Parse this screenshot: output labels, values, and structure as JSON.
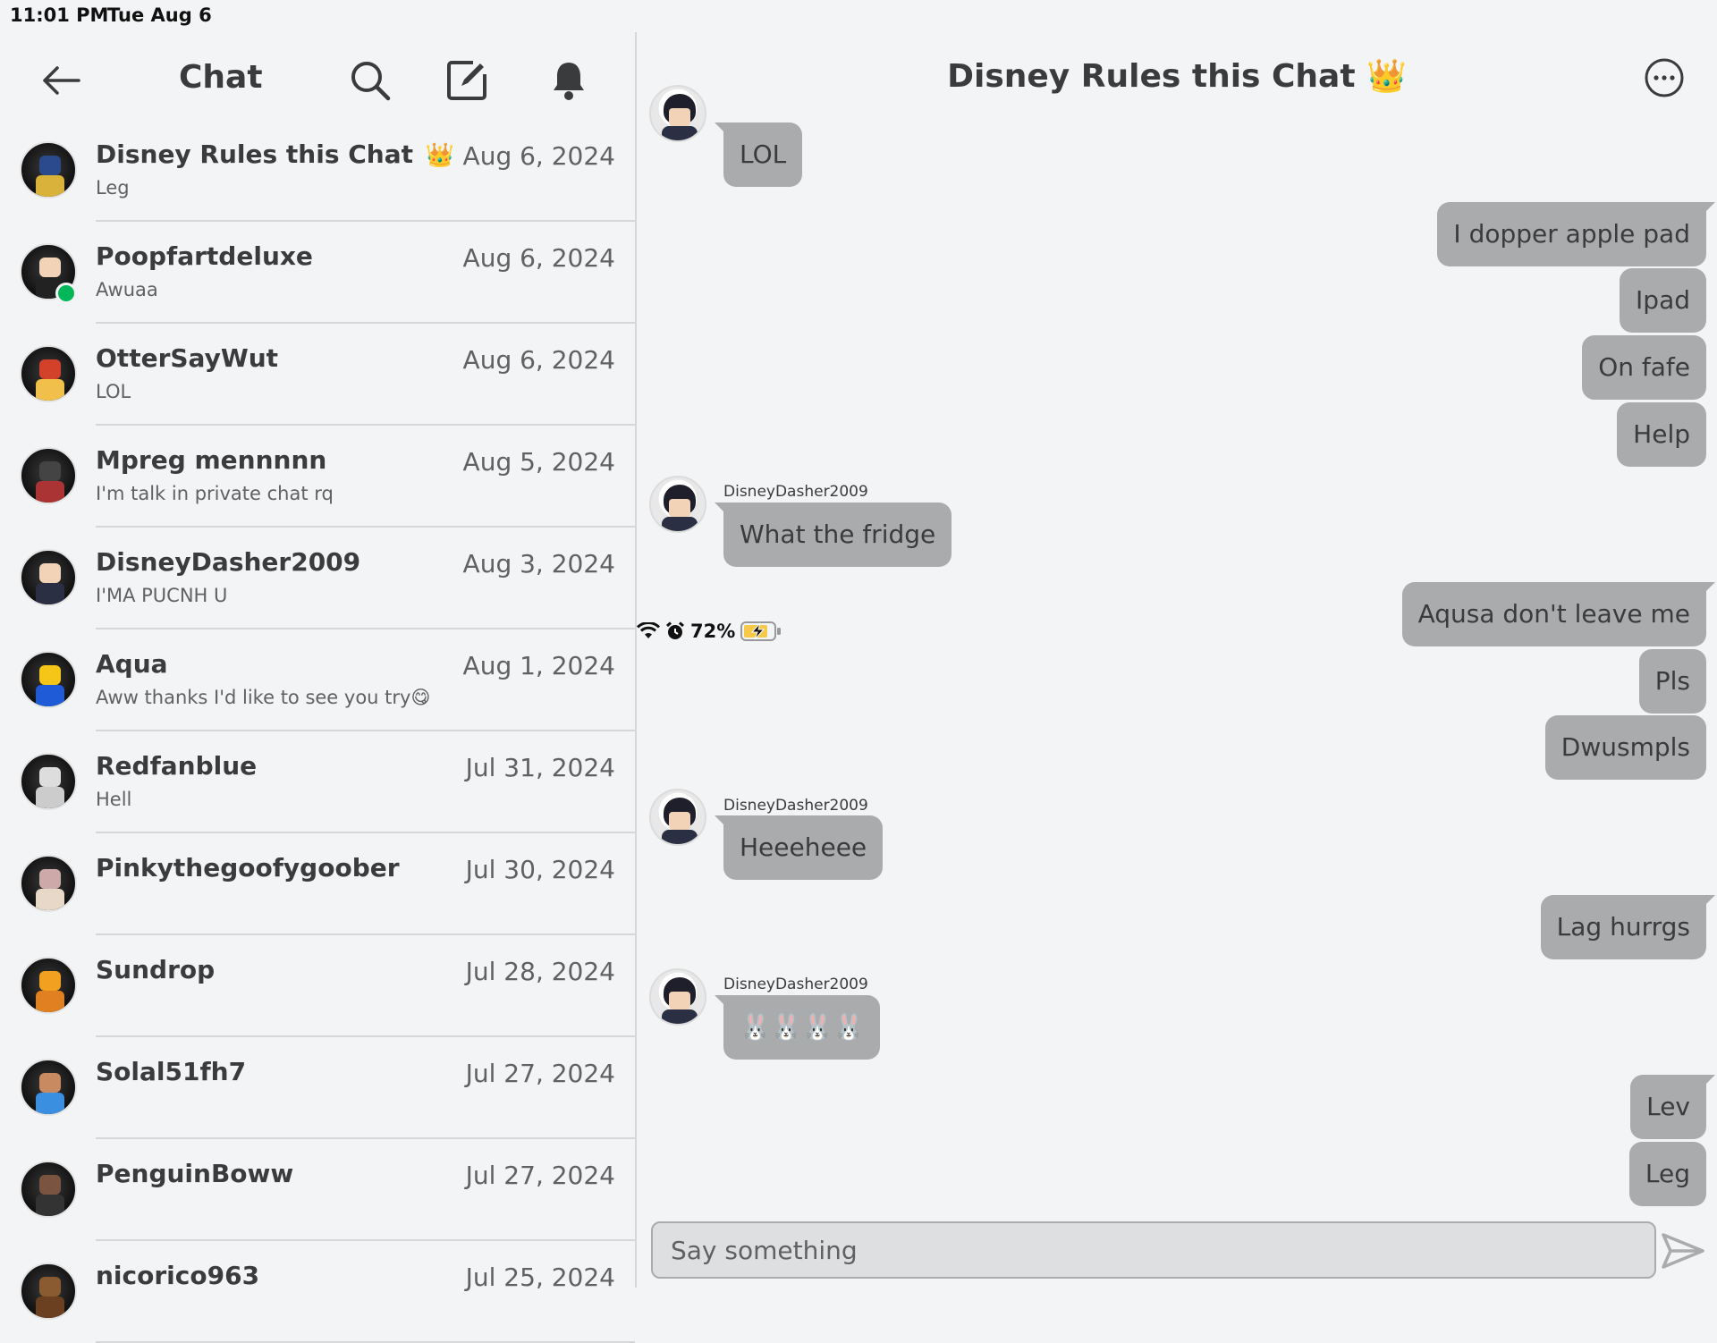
{
  "status_bar": {
    "time": "11:01 PM",
    "date": "Tue Aug 6",
    "battery": "72%",
    "icons": [
      "wifi-icon",
      "alarm-icon",
      "battery-charging-icon"
    ]
  },
  "left_panel": {
    "title": "Chat",
    "icons": [
      "back-arrow-icon",
      "search-icon",
      "compose-icon",
      "bell-icon"
    ],
    "conversations": [
      {
        "name": "Disney Rules this Chat",
        "crown": "👑",
        "date": "Aug 6, 2024",
        "preview": "Leg"
      },
      {
        "name": "Poopfartdeluxe",
        "date": "Aug 6, 2024",
        "preview": "Awuaa",
        "online": true
      },
      {
        "name": "OtterSayWut",
        "date": "Aug 6, 2024",
        "preview": "LOL"
      },
      {
        "name": "Mpreg mennnnn",
        "date": "Aug 5, 2024",
        "preview": "I'm talk in private chat rq"
      },
      {
        "name": "DisneyDasher2009",
        "date": "Aug 3, 2024",
        "preview": "I'MA PUCNH U"
      },
      {
        "name": "Aqua",
        "date": "Aug 1, 2024",
        "preview": "Aww thanks I'd like to see you try😋"
      },
      {
        "name": "Redfanblue",
        "date": "Jul 31, 2024",
        "preview": "Hell"
      },
      {
        "name": "Pinkythegoofygoober",
        "date": "Jul 30, 2024",
        "preview": ""
      },
      {
        "name": "Sundrop",
        "date": "Jul 28, 2024",
        "preview": ""
      },
      {
        "name": "Solal51fh7",
        "date": "Jul 27, 2024",
        "preview": ""
      },
      {
        "name": "PenguinBoww",
        "date": "Jul 27, 2024",
        "preview": ""
      },
      {
        "name": "nicorico963",
        "date": "Jul 25, 2024",
        "preview": ""
      }
    ]
  },
  "chat": {
    "title": "Disney Rules this Chat 👑",
    "messages": [
      {
        "dir": "in",
        "text": "LOL"
      },
      {
        "dir": "out",
        "text": "I dopper apple pad"
      },
      {
        "dir": "out",
        "text": "Ipad"
      },
      {
        "dir": "out",
        "text": "On fafe"
      },
      {
        "dir": "out",
        "text": "Help"
      },
      {
        "dir": "in",
        "sender": "DisneyDasher2009",
        "text": "What the fridge"
      },
      {
        "dir": "out",
        "text": "Aqusa don't leave me"
      },
      {
        "dir": "out",
        "text": "Pls"
      },
      {
        "dir": "out",
        "text": "Dwusmpls"
      },
      {
        "dir": "in",
        "sender": "DisneyDasher2009",
        "text": "Heeeheee"
      },
      {
        "dir": "out",
        "text": "Lag hurrgs"
      },
      {
        "dir": "in",
        "sender": "DisneyDasher2009",
        "text": "🐰🐰🐰🐰"
      },
      {
        "dir": "out",
        "text": "Lev"
      },
      {
        "dir": "out",
        "text": "Leg"
      }
    ],
    "composer_placeholder": "Say something"
  },
  "colors": {
    "background": "#f2f4f5",
    "bubble": "#a9abad",
    "text": "#393b3d",
    "online": "#02b757"
  }
}
